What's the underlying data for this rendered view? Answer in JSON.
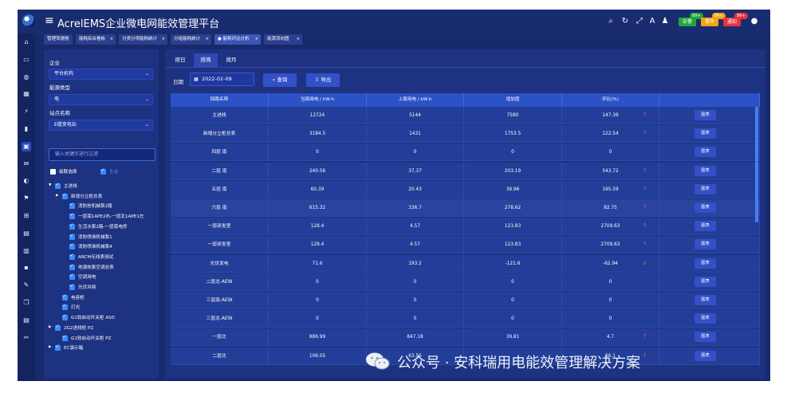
{
  "app": {
    "title": "AcrelEMS企业微电网能效管理平台",
    "badges": [
      {
        "label": "告警",
        "count": "99+",
        "color": "#1fa83a"
      },
      {
        "label": "事件",
        "count": "99+",
        "color": "#f0a612"
      },
      {
        "label": "通知",
        "count": "99+",
        "color": "#e8343a"
      }
    ]
  },
  "page_tabs": [
    {
      "label": "管理驾驶舱",
      "closable": false
    },
    {
      "label": "能耗综合看板",
      "closable": true
    },
    {
      "label": "分类分项能耗统计",
      "closable": true
    },
    {
      "label": "分组能耗统计",
      "closable": true
    },
    {
      "label": "能耗环比分析",
      "closable": true,
      "active": true
    },
    {
      "label": "能源流向图",
      "closable": true
    }
  ],
  "filter": {
    "enterprise_label": "企业",
    "enterprise_value": "平台机构",
    "energy_label": "能源类型",
    "energy_value": "电",
    "station_label": "站点名称",
    "station_value": "E楼变电站",
    "search_placeholder": "输入关键字进行过滤",
    "cascade_label": "级联选择",
    "select_all_label": "全选"
  },
  "tree": [
    {
      "label": "主进线",
      "level": 0,
      "arrow": "down",
      "checked": true
    },
    {
      "label": "新增分立柜总表",
      "level": 1,
      "arrow": "right",
      "checked": true
    },
    {
      "label": "消防栓机械泵2路",
      "level": 2,
      "checked": true
    },
    {
      "label": "一层南1APE2右-一层北1APE1左",
      "level": 2,
      "checked": true
    },
    {
      "label": "生活水泵2路-一层南电房",
      "level": 2,
      "checked": true
    },
    {
      "label": "消防喷淋机械泵1",
      "level": 2,
      "checked": true
    },
    {
      "label": "消防喷淋机械泵4",
      "level": 2,
      "checked": true
    },
    {
      "label": "ARCM无线表测试",
      "level": 2,
      "checked": true
    },
    {
      "label": "地源热泵空调总表",
      "level": 2,
      "checked": true
    },
    {
      "label": "空调用电",
      "level": 2,
      "checked": true
    },
    {
      "label": "光伏并网",
      "level": 2,
      "checked": true
    },
    {
      "label": "电容柜",
      "level": 1,
      "checked": true
    },
    {
      "label": "灯光",
      "level": 1,
      "checked": true
    },
    {
      "label": "G1软启动开关柜 ASD",
      "level": 1,
      "checked": true
    },
    {
      "label": "2G2进线柜 PZ",
      "level": 0,
      "arrow": "right",
      "checked": true
    },
    {
      "label": "G1软启动开关柜 PZ",
      "level": 1,
      "checked": true
    },
    {
      "label": "EC演示箱",
      "level": 0,
      "arrow": "right",
      "checked": true
    }
  ],
  "period_tabs": [
    {
      "label": "按日",
      "active": false
    },
    {
      "label": "按周",
      "active": true
    },
    {
      "label": "按月",
      "active": false
    }
  ],
  "query": {
    "date_label": "日期",
    "date_value": "2022-02-09",
    "query_label": "查询",
    "export_label": "导出"
  },
  "table": {
    "columns": [
      "回路名称",
      "当周用电 / kW·h",
      "上周用电 / kW·h",
      "增加值",
      "环比(%)",
      ""
    ],
    "chart_button_label": "图表",
    "rows": [
      {
        "name": "主进线",
        "current": "12724",
        "previous": "5144",
        "increase": "7580",
        "ratio": "147.36",
        "trend": "up"
      },
      {
        "name": "新增分立柜总表",
        "current": "3184.5",
        "previous": "1431",
        "increase": "1753.5",
        "ratio": "122.54",
        "trend": "up"
      },
      {
        "name": "四层 南",
        "current": "0",
        "previous": "0",
        "increase": "0",
        "ratio": "0",
        "trend": ""
      },
      {
        "name": "二层 南",
        "current": "240.56",
        "previous": "37.37",
        "increase": "203.19",
        "ratio": "543.72",
        "trend": "up"
      },
      {
        "name": "五层 南",
        "current": "60.39",
        "previous": "20.43",
        "increase": "39.96",
        "ratio": "195.59",
        "trend": "up"
      },
      {
        "name": "六层 南",
        "current": "615.32",
        "previous": "336.7",
        "increase": "278.62",
        "ratio": "82.75",
        "trend": "up"
      },
      {
        "name": "一层研发室",
        "current": "128.4",
        "previous": "4.57",
        "increase": "123.83",
        "ratio": "2709.63",
        "trend": "up"
      },
      {
        "name": "一层研发室",
        "current": "128.4",
        "previous": "4.57",
        "increase": "123.83",
        "ratio": "2709.63",
        "trend": "up"
      },
      {
        "name": "光伏发电",
        "current": "71.6",
        "previous": "193.2",
        "increase": "-121.6",
        "ratio": "-62.94",
        "trend": "down"
      },
      {
        "name": "二层北-AEW",
        "current": "0",
        "previous": "0",
        "increase": "0",
        "ratio": "0",
        "trend": ""
      },
      {
        "name": "三层南-AEW",
        "current": "0",
        "previous": "0",
        "increase": "0",
        "ratio": "0",
        "trend": ""
      },
      {
        "name": "三层北-AEW",
        "current": "0",
        "previous": "0",
        "increase": "0",
        "ratio": "0",
        "trend": ""
      },
      {
        "name": "一层北",
        "current": "886.99",
        "previous": "847.18",
        "increase": "39.81",
        "ratio": "4.7",
        "trend": "up"
      },
      {
        "name": "二层北",
        "current": "106.05",
        "previous": "63.55",
        "increase": "",
        "ratio": "66.1",
        "trend": "up"
      }
    ]
  },
  "watermark": "公众号 · 安科瑞用电能效管理解决方案",
  "colors": {
    "trend_up": "#ff4d4f",
    "trend_down": "#52c41a",
    "accent": "#3350c6"
  }
}
